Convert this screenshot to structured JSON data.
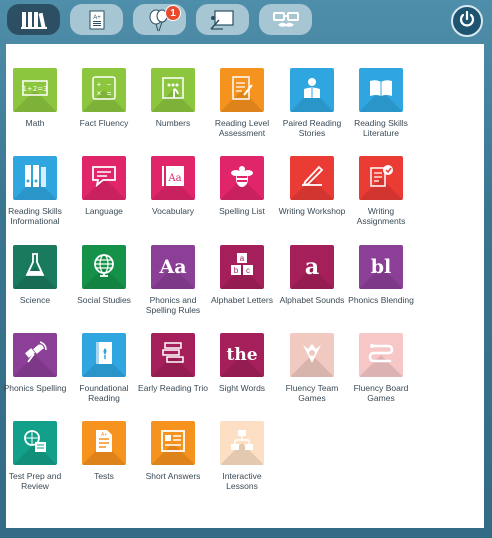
{
  "topbar": {
    "notification_count": "1",
    "buttons": [
      {
        "name": "library-icon"
      },
      {
        "name": "grades-icon"
      },
      {
        "name": "balloons-icon"
      },
      {
        "name": "presentation-icon"
      },
      {
        "name": "disguise-glasses-icon"
      }
    ]
  },
  "tiles": [
    {
      "label": "Math",
      "color": "#8cc63e",
      "icon": "math-icon"
    },
    {
      "label": "Fact Fluency",
      "color": "#8cc63e",
      "icon": "fact-fluency-icon"
    },
    {
      "label": "Numbers",
      "color": "#8cc63e",
      "icon": "numbers-icon"
    },
    {
      "label": "Reading Level Assessment",
      "color": "#f6921e",
      "icon": "assessment-icon"
    },
    {
      "label": "Paired Reading Stories",
      "color": "#2fa6e0",
      "icon": "paired-reading-icon"
    },
    {
      "label": "Reading Skills Literature",
      "color": "#2fa6e0",
      "icon": "book-icon"
    },
    {
      "label": "Reading Skills Informational",
      "color": "#2fa6e0",
      "icon": "binders-icon"
    },
    {
      "label": "Language",
      "color": "#e0256a",
      "icon": "speech-bubble-icon"
    },
    {
      "label": "Vocabulary",
      "color": "#e0256a",
      "icon": "dictionary-icon"
    },
    {
      "label": "Spelling List",
      "color": "#e0256a",
      "icon": "bee-icon"
    },
    {
      "label": "Writing Workshop",
      "color": "#ea3b35",
      "icon": "pencil-paper-icon"
    },
    {
      "label": "Writing Assignments",
      "color": "#ea3b35",
      "icon": "assignment-icon"
    },
    {
      "label": "Science",
      "color": "#1a7a5e",
      "icon": "flask-icon"
    },
    {
      "label": "Social Studies",
      "color": "#159249",
      "icon": "globe-icon"
    },
    {
      "label": "Phonics and Spelling Rules",
      "color": "#8c3f97",
      "icon": "phonics-rules-icon",
      "glyph": "Aa"
    },
    {
      "label": "Alphabet Letters",
      "color": "#a5205a",
      "icon": "abc-blocks-icon"
    },
    {
      "label": "Alphabet Sounds",
      "color": "#a5205a",
      "icon": "alphabet-sounds-icon",
      "glyph": "a"
    },
    {
      "label": "Phonics Blending",
      "color": "#8c3f97",
      "icon": "blending-icon",
      "glyph": "bl"
    },
    {
      "label": "Phonics Spelling",
      "color": "#8c3f97",
      "icon": "satellite-icon"
    },
    {
      "label": "Foundational Reading",
      "color": "#2fa6e0",
      "icon": "foundational-book-icon"
    },
    {
      "label": "Early Reading Trio",
      "color": "#a5205a",
      "icon": "trio-icon"
    },
    {
      "label": "Sight Words",
      "color": "#a5205a",
      "icon": "sight-words-icon",
      "glyph": "the"
    },
    {
      "label": "Fluency Team Games",
      "color": "#f0c9c0",
      "icon": "team-games-icon"
    },
    {
      "label": "Fluency Board Games",
      "color": "#f7c7c7",
      "icon": "board-games-icon"
    },
    {
      "label": "Test Prep and Review",
      "color": "#12a08a",
      "icon": "test-prep-icon"
    },
    {
      "label": "Tests",
      "color": "#f6921e",
      "icon": "tests-icon"
    },
    {
      "label": "Short Answers",
      "color": "#f6921e",
      "icon": "short-answers-icon"
    },
    {
      "label": "Interactive Lessons",
      "color": "#fde0c3",
      "icon": "interactive-lessons-icon"
    }
  ]
}
